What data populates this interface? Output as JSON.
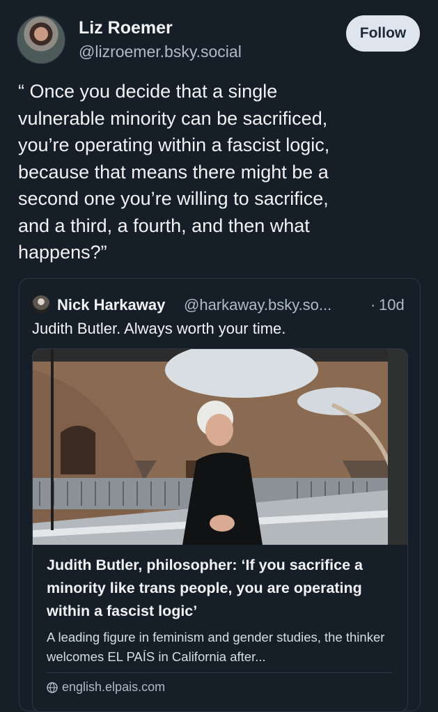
{
  "post": {
    "author_name": "Liz Roemer",
    "author_handle": "@lizroemer.bsky.social",
    "follow_label": "Follow",
    "text": "“ Once you decide that a single\nvulnerable minority can be sacrificed,\nyou’re operating within a fascist logic,\nbecause that means there might be a\nsecond one you’re willing to sacrifice,\nand a third, a fourth, and then what\nhappens?”"
  },
  "quoted_post": {
    "author_name": "Nick Harkaway",
    "author_handle": "@harkaway.bsky.so...",
    "separator": "·",
    "age": "10d",
    "text": "Judith Butler. Always worth your time.",
    "link_card": {
      "title": "Judith Butler, philosopher: ‘If you sacrifice a minority like trans people, you are operating within a fascist logic’",
      "description": "A leading figure in feminism and gender studies, the thinker welcomes EL PAÍS in California after...",
      "domain": "english.elpais.com"
    }
  },
  "colors": {
    "background": "#161e27",
    "primary_text": "#f1f3f5",
    "secondary_text": "#aebbc9",
    "follow_button_bg": "#dfe5ee",
    "border": "#2c3945"
  }
}
